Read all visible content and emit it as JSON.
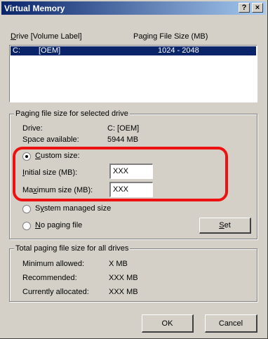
{
  "window": {
    "title": "Virtual Memory",
    "help_button": "?",
    "close_button": "×"
  },
  "list": {
    "column_drive": "Drive  [Volume Label]",
    "column_drive_accel": "D",
    "column_paging": "Paging File Size (MB)",
    "rows": [
      {
        "drive": "C:",
        "label": "[OEM]",
        "size": "1024 - 2048"
      }
    ]
  },
  "selected_drive": {
    "legend": "Paging file size for selected drive",
    "drive_label": "Drive:",
    "drive_value": "C:  [OEM]",
    "space_label": "Space available:",
    "space_value": "5944 MB",
    "custom_size": {
      "accel": "C",
      "rest": "ustom size:"
    },
    "initial_size": {
      "accel": "I",
      "rest": "nitial size (MB):",
      "value": "XXX"
    },
    "maximum_size": {
      "pre": "Ma",
      "accel": "x",
      "rest": "imum size (MB):",
      "value": "XXX"
    },
    "system_managed": {
      "pre": "S",
      "accel": "y",
      "rest": "stem managed size"
    },
    "no_paging": {
      "accel": "N",
      "rest": "o paging file"
    },
    "set_button": {
      "accel": "S",
      "rest": "et"
    },
    "selected_option": "custom"
  },
  "totals": {
    "legend": "Total paging file size for all drives",
    "min_label": "Minimum allowed:",
    "min_value": "X MB",
    "rec_label": "Recommended:",
    "rec_value": "XXX MB",
    "cur_label": "Currently allocated:",
    "cur_value": "XXX MB"
  },
  "buttons": {
    "ok": "OK",
    "cancel": "Cancel"
  },
  "colors": {
    "highlight_annotation": "#ee1111",
    "title_bar": "#0a246a",
    "selection": "#0a246a"
  }
}
